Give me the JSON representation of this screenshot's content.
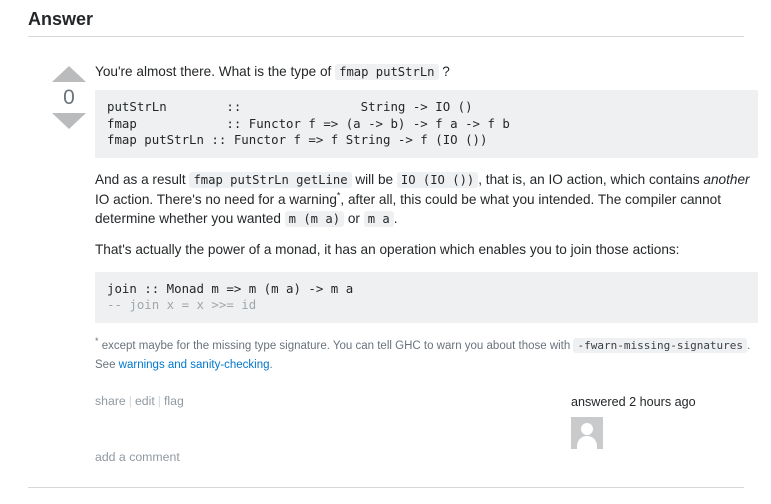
{
  "header": {
    "title": "Answer"
  },
  "vote": {
    "up_icon": "triangle-up-icon",
    "down_icon": "triangle-down-icon",
    "score": "0"
  },
  "post": {
    "para1": {
      "before": "You're almost there. What is the type of ",
      "code": "fmap putStrLn",
      "after": " ?"
    },
    "code_block_1": "putStrLn        ::                String -> IO ()\nfmap            :: Functor f => (a -> b) -> f a -> f b\nfmap putStrLn :: Functor f => f String -> f (IO ())",
    "para2": {
      "seg1": "And as a result ",
      "code1": "fmap putStrLn getLine",
      "seg2": " will be ",
      "code2": "IO (IO ())",
      "seg3": ", that is, an IO action, which contains ",
      "em1": "another",
      "seg4": " IO action. There's no need for a warning",
      "fnmark": "*",
      "seg5": ", after all, this could be what you intended. The compiler cannot determine whether you wanted ",
      "code3": "m (m a)",
      "seg6": " or ",
      "code4": "m a",
      "seg7": "."
    },
    "para3": "That's actually the power of a monad, it has an operation which enables you to join those actions:",
    "code_block_2_main": "join :: Monad m => m (m a) -> m a",
    "code_block_2_comment": "-- join x = x >>= id",
    "footnote": {
      "mark": "*",
      "seg1": " except maybe for the missing type signature. You can tell GHC to warn you about those with ",
      "code": "-fwarn-missing-signatures",
      "seg2": ". See ",
      "link": "warnings and sanity-checking",
      "seg3": "."
    }
  },
  "post_menu": {
    "share": "share",
    "edit": "edit",
    "flag": "flag",
    "separator": "|"
  },
  "signature": {
    "time": "answered 2 hours ago",
    "avatar_icon": "user-avatar-icon"
  },
  "comments": {
    "add_label": "add a comment"
  },
  "colors": {
    "code_bg": "#eff0f1",
    "divider": "#d6d9dc",
    "link": "#0077cc",
    "muted": "#9199a1",
    "vote_arrow": "#b9bbbd",
    "avatar_bg": "#c8cacb"
  }
}
